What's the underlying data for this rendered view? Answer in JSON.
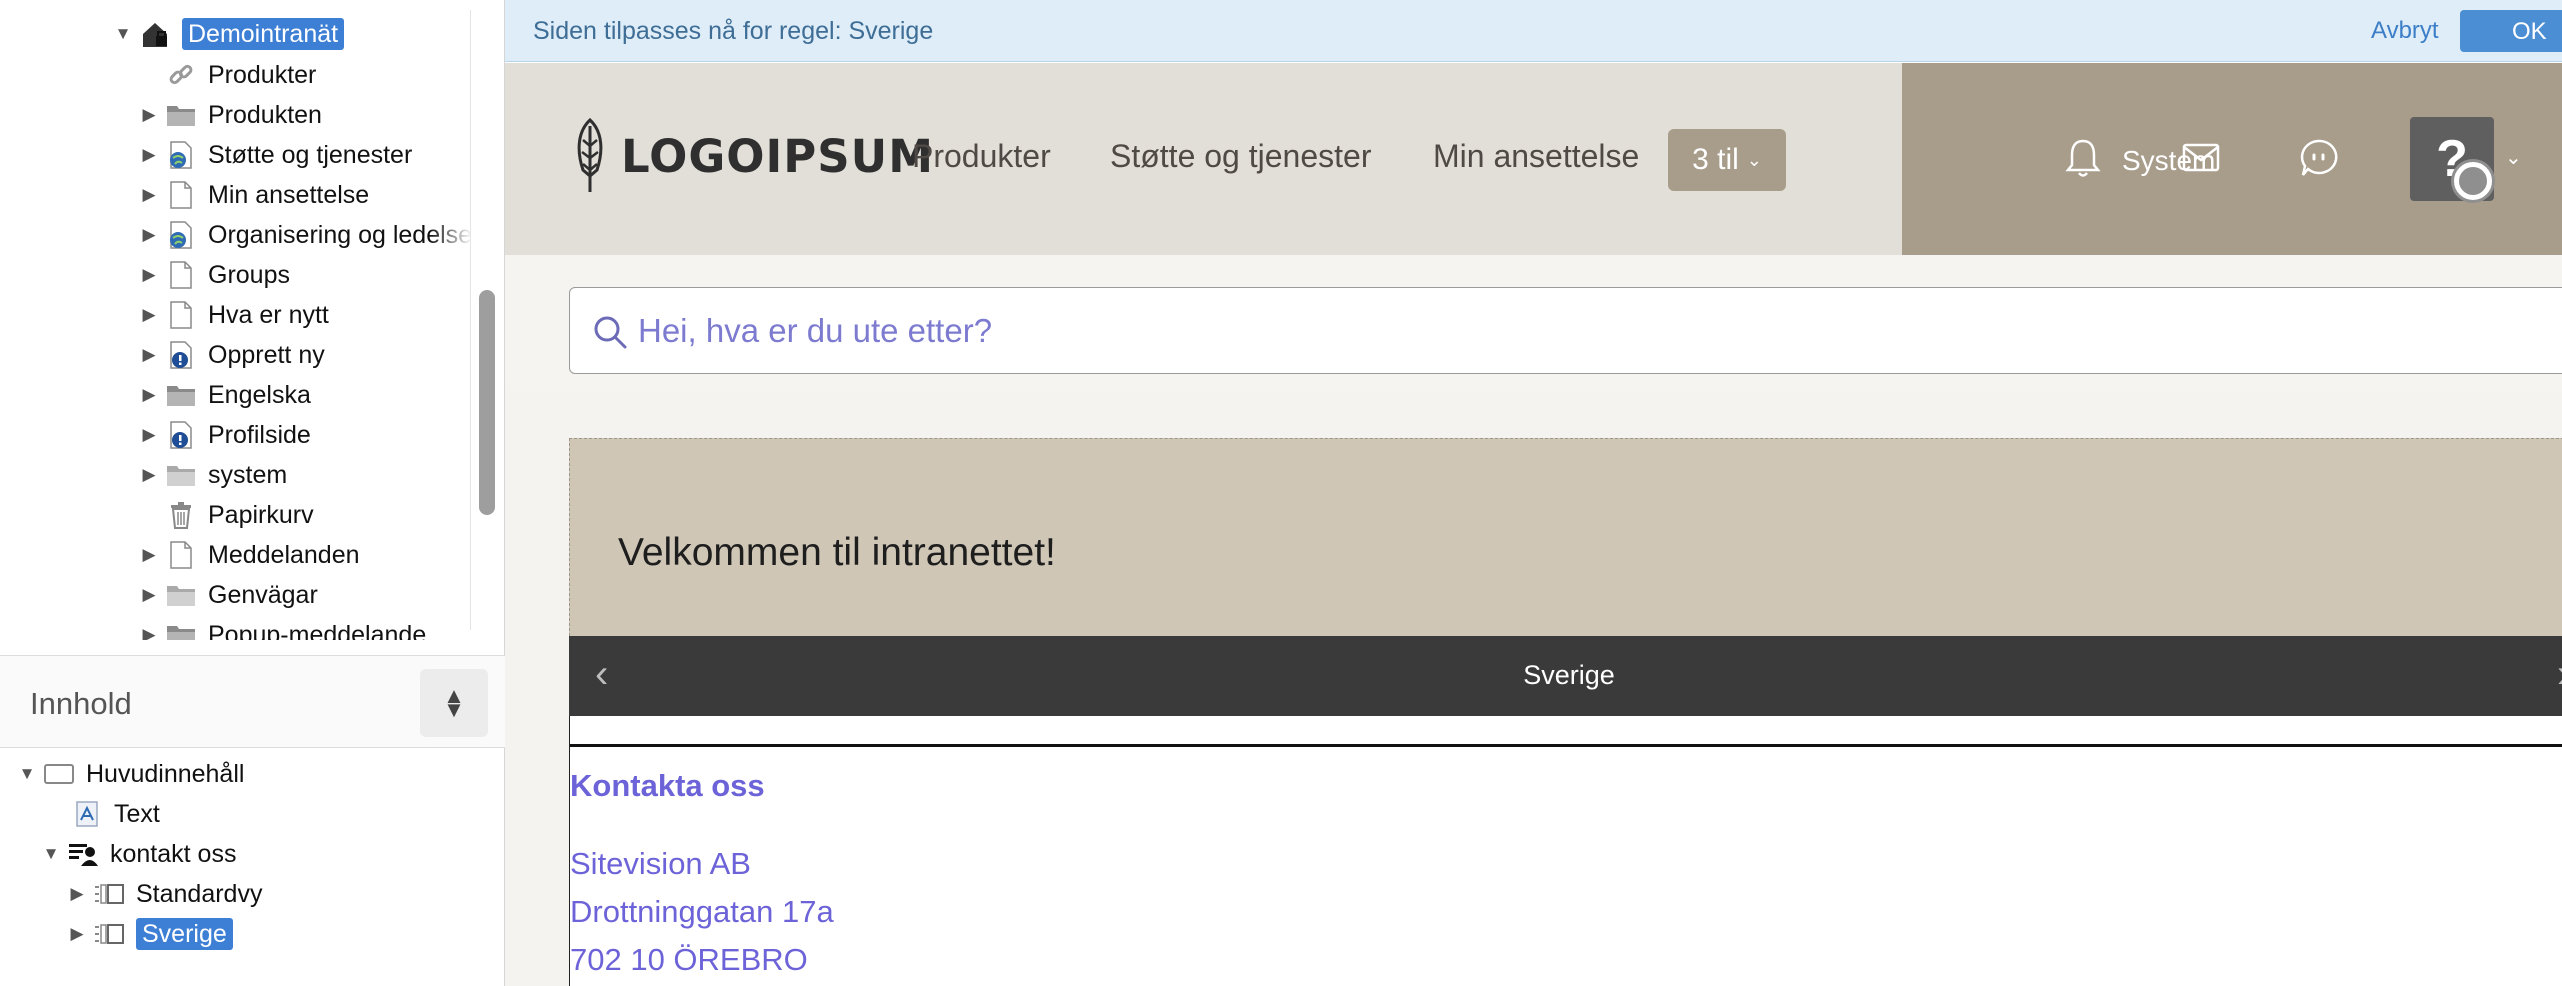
{
  "site_tree": [
    {
      "label": "Demointranät",
      "icon": "home-lock-icon",
      "expanded": true,
      "selected": true
    },
    {
      "label": "Produkter",
      "icon": "link-icon"
    },
    {
      "label": "Produkten",
      "icon": "folder-icon"
    },
    {
      "label": "Støtte og tjenester",
      "icon": "globe-page-icon"
    },
    {
      "label": "Min ansettelse",
      "icon": "page-icon"
    },
    {
      "label": "Organisering og ledelse",
      "icon": "globe-page-icon"
    },
    {
      "label": "Groups",
      "icon": "page-icon"
    },
    {
      "label": "Hva er nytt",
      "icon": "page-icon"
    },
    {
      "label": "Opprett ny",
      "icon": "info-page-icon"
    },
    {
      "label": "Engelska",
      "icon": "folder-icon"
    },
    {
      "label": "Profilside",
      "icon": "info-page-icon"
    },
    {
      "label": "system",
      "icon": "folder-icon"
    },
    {
      "label": "Papirkurv",
      "icon": "trash-icon"
    },
    {
      "label": "Meddelanden",
      "icon": "page-icon"
    },
    {
      "label": "Genvägar",
      "icon": "folder-icon"
    },
    {
      "label": "Popup-meddelande",
      "icon": "folder-icon"
    }
  ],
  "content_panel": {
    "title": "Innhold",
    "tree": [
      {
        "label": "Huvudinnehåll",
        "icon": "layout-icon",
        "expanded": true
      },
      {
        "label": "Text",
        "icon": "text-module-icon"
      },
      {
        "label": "kontakt oss",
        "icon": "contact-module-icon",
        "expanded": true
      },
      {
        "label": "Standardvy",
        "icon": "view-icon"
      },
      {
        "label": "Sverige",
        "icon": "view-icon",
        "selected": true
      }
    ]
  },
  "notice": {
    "text": "Siden tilpasses nå for regel: Sverige",
    "cancel": "Avbryt",
    "ok": "OK"
  },
  "header": {
    "logo": "LOGOIPSUM",
    "nav": [
      "Produkter",
      "Støtte og tjenester",
      "Min ansettelse"
    ],
    "more": "3 til",
    "user": "System",
    "avatar": "?"
  },
  "search": {
    "placeholder": "Hei, hva er du ute etter?"
  },
  "page_content": {
    "welcome": "Velkommen til intranettet!",
    "variant_title": "Sverige",
    "contact_title": "Kontakta oss",
    "address": [
      "Sitevision AB",
      "Drottninggatan 17a",
      "702 10 ÖREBRO"
    ]
  },
  "colors": {
    "selection": "#3e7fd6",
    "header_bg": "#e2ded8",
    "header_accent": "#a89c8b",
    "welcome_bg": "#cfc6b6",
    "tab_bar": "#3a3a3a",
    "link": "#6d63d8",
    "notice_bg": "#deedf8"
  }
}
